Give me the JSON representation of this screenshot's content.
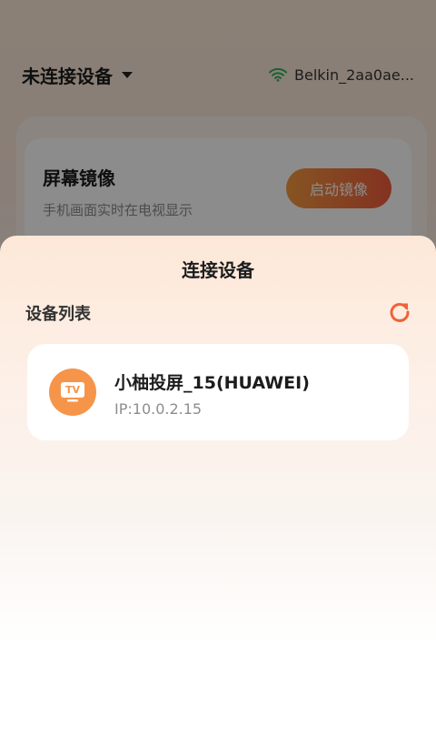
{
  "topbar": {
    "device_status": "未连接设备",
    "wifi_name": "Belkin_2aa0ae..."
  },
  "mirror_card": {
    "title": "屏幕镜像",
    "description": "手机画面实时在电视显示",
    "button_label": "启动镜像"
  },
  "sheet": {
    "title": "连接设备",
    "section_label": "设备列表",
    "devices": [
      {
        "name": "小柚投屏_15(HUAWEI)",
        "ip": "IP:10.0.2.15",
        "icon_text": "TV"
      }
    ]
  },
  "colors": {
    "accent": "#f0623a",
    "accent_orange": "#f6954a",
    "wifi_green": "#2bb35a"
  }
}
